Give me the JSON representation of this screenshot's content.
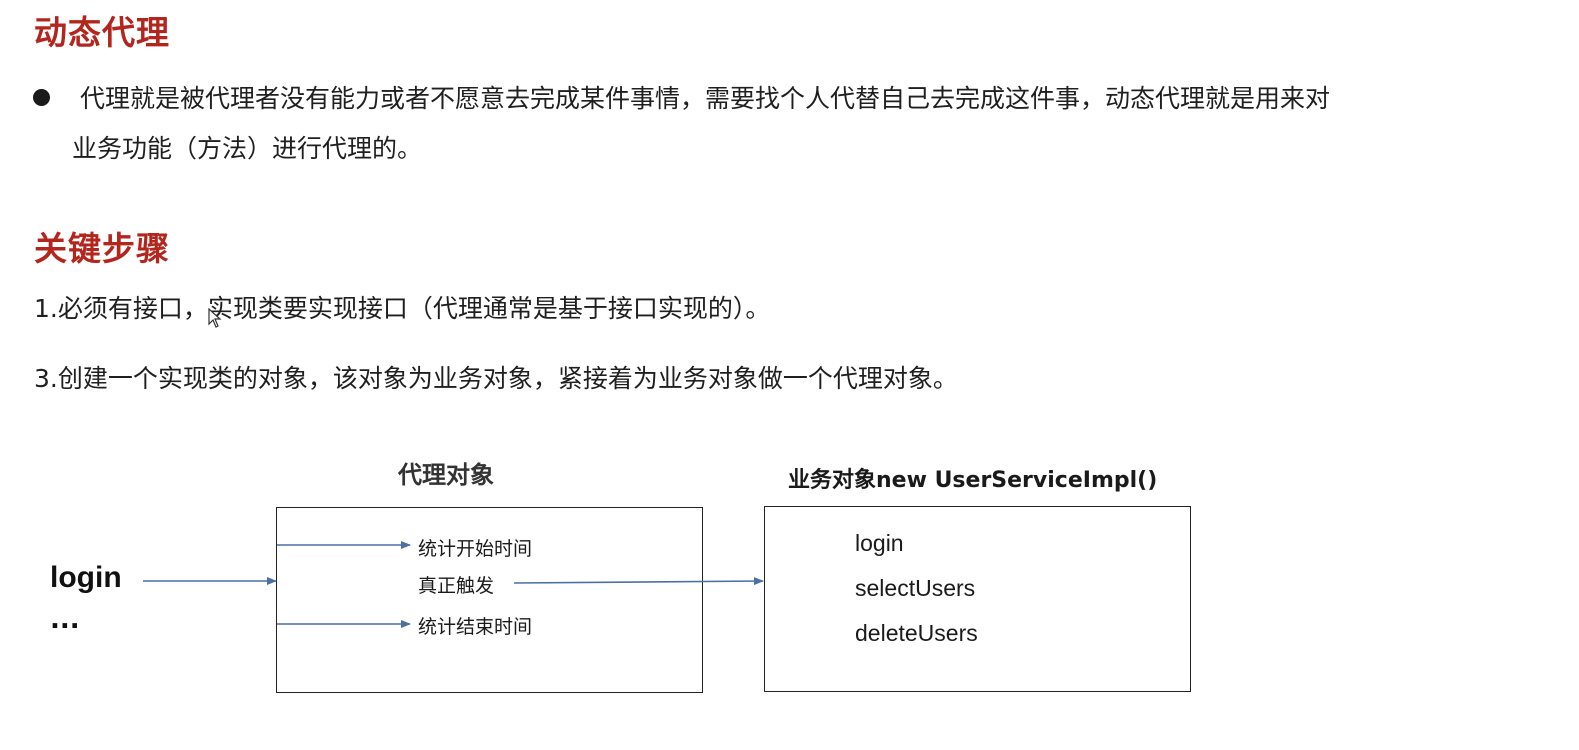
{
  "section1": {
    "title": "动态代理",
    "bullet_line1": "代理就是被代理者没有能力或者不愿意去完成某件事情，需要找个人代替自己去完成这件事，动态代理就是用来对",
    "bullet_line2": "业务功能（方法）进行代理的。"
  },
  "section2": {
    "title": "关键步骤",
    "step1": "1.必须有接口，实现类要实现接口（代理通常是基于接口实现的）。",
    "step3": "3.创建一个实现类的对象，该对象为业务对象，紧接着为业务对象做一个代理对象。"
  },
  "diagram": {
    "caller_method": "login",
    "caller_more": "...",
    "proxy": {
      "title": "代理对象",
      "steps": [
        "统计开始时间",
        "真正触发",
        "统计结束时间"
      ]
    },
    "business": {
      "title": "业务对象new UserServiceImpl()",
      "methods": [
        "login",
        "selectUsers",
        "deleteUsers"
      ]
    },
    "colors": {
      "heading": "#b3261e",
      "arrow": "#4a6fa5"
    }
  }
}
